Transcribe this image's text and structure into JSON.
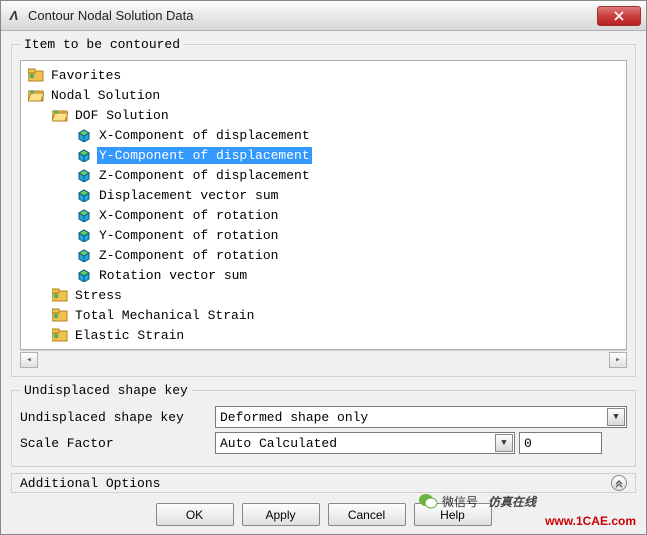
{
  "window": {
    "title": "Contour Nodal Solution Data",
    "app_glyph": "Λ"
  },
  "group": {
    "contour_legend": "Item to be contoured",
    "shape_legend": "Undisplaced shape key",
    "additional": "Additional Options"
  },
  "tree": {
    "favorites": "Favorites",
    "nodal": "Nodal Solution",
    "dof": "DOF Solution",
    "items": {
      "xdisp": "X-Component of displacement",
      "ydisp": "Y-Component of displacement",
      "zdisp": "Z-Component of displacement",
      "dispsum": "Displacement vector sum",
      "xrot": "X-Component of rotation",
      "yrot": "Y-Component of rotation",
      "zrot": "Z-Component of rotation",
      "rotsum": "Rotation vector sum"
    },
    "stress": "Stress",
    "totmech": "Total Mechanical Strain",
    "elastic": "Elastic Strain"
  },
  "shape": {
    "label1": "Undisplaced shape key",
    "value1": "Deformed shape only",
    "label2": "Scale Factor",
    "value2": "Auto Calculated",
    "scale_input": "0"
  },
  "buttons": {
    "ok": "OK",
    "apply": "Apply",
    "cancel": "Cancel",
    "help": "Help"
  },
  "overlay": {
    "wechat": "微信号",
    "brand": "仿真在线",
    "site": "www.1CAE.com"
  }
}
